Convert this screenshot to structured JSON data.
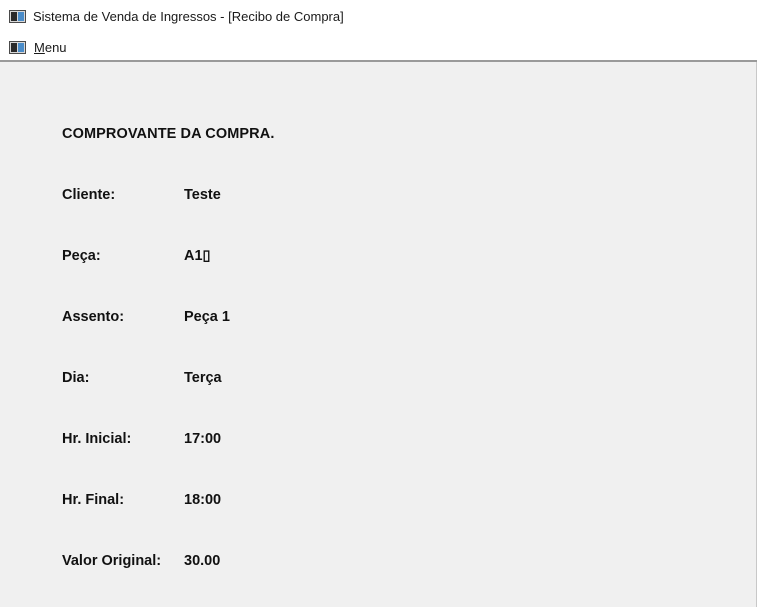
{
  "window": {
    "title": "Sistema de Venda de Ingressos - [Recibo de Compra]",
    "icon": "app-window-icon"
  },
  "menubar": {
    "items": [
      {
        "label_mnemonic": "M",
        "label_rest": "enu"
      }
    ]
  },
  "receipt": {
    "heading": "COMPROVANTE DA COMPRA.",
    "fields": [
      {
        "label": "Cliente:",
        "value": "Teste"
      },
      {
        "label": "Peça:",
        "value": "A1▯"
      },
      {
        "label": "Assento:",
        "value": "Peça 1"
      },
      {
        "label": "Dia:",
        "value": "Terça"
      },
      {
        "label": "Hr. Inicial:",
        "value": "17:00"
      },
      {
        "label": "Hr. Final:",
        "value": "18:00"
      },
      {
        "label": "Valor Original:",
        "value": "30.00"
      }
    ]
  },
  "colors": {
    "client_background": "#f0f0f0",
    "text": "#111111",
    "chrome_background": "#ffffff"
  }
}
